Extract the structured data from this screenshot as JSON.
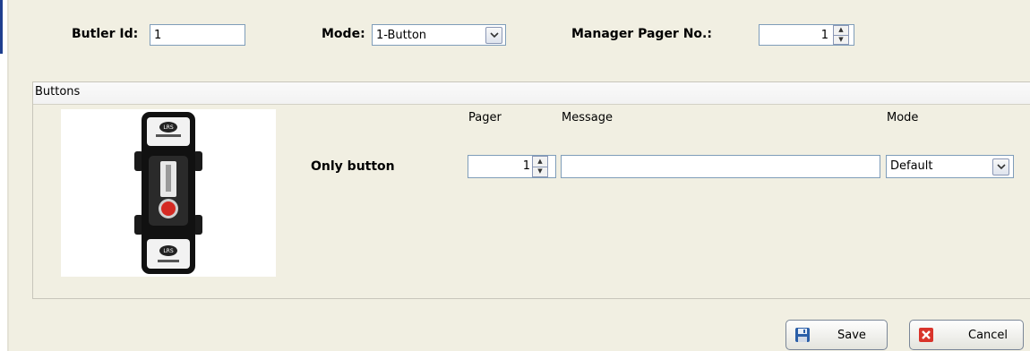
{
  "header": {
    "butler_id_label": "Butler Id:",
    "butler_id_value": "1",
    "mode_label": "Mode:",
    "mode_value": "1-Button",
    "manager_pager_label": "Manager Pager No.:",
    "manager_pager_value": "1"
  },
  "buttons_group": {
    "title": "Buttons",
    "columns": {
      "pager": "Pager",
      "message": "Message",
      "mode": "Mode"
    },
    "rows": [
      {
        "label": "Only button",
        "pager": "1",
        "message": "",
        "mode": "Default"
      }
    ]
  },
  "footer": {
    "save_label": "Save",
    "cancel_label": "Cancel"
  },
  "icons": {
    "dropdown": "chevron-down-icon",
    "spin_up": "arrow-up-icon",
    "spin_down": "arrow-down-icon",
    "save": "floppy-disk-icon",
    "cancel": "close-icon",
    "device": "butler-device-image"
  },
  "colors": {
    "window_bg": "#f1efe2",
    "input_border": "#7f9db9",
    "cancel_red": "#d9342b",
    "save_blue": "#2a5ea8"
  }
}
